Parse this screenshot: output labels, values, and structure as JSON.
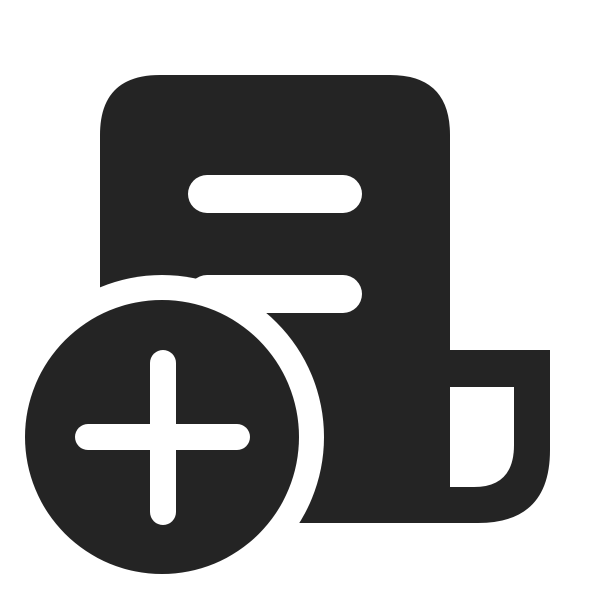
{
  "icon": {
    "name": "receipt-add-icon",
    "glyph_color": "#242424",
    "background_color": "#ffffff"
  }
}
